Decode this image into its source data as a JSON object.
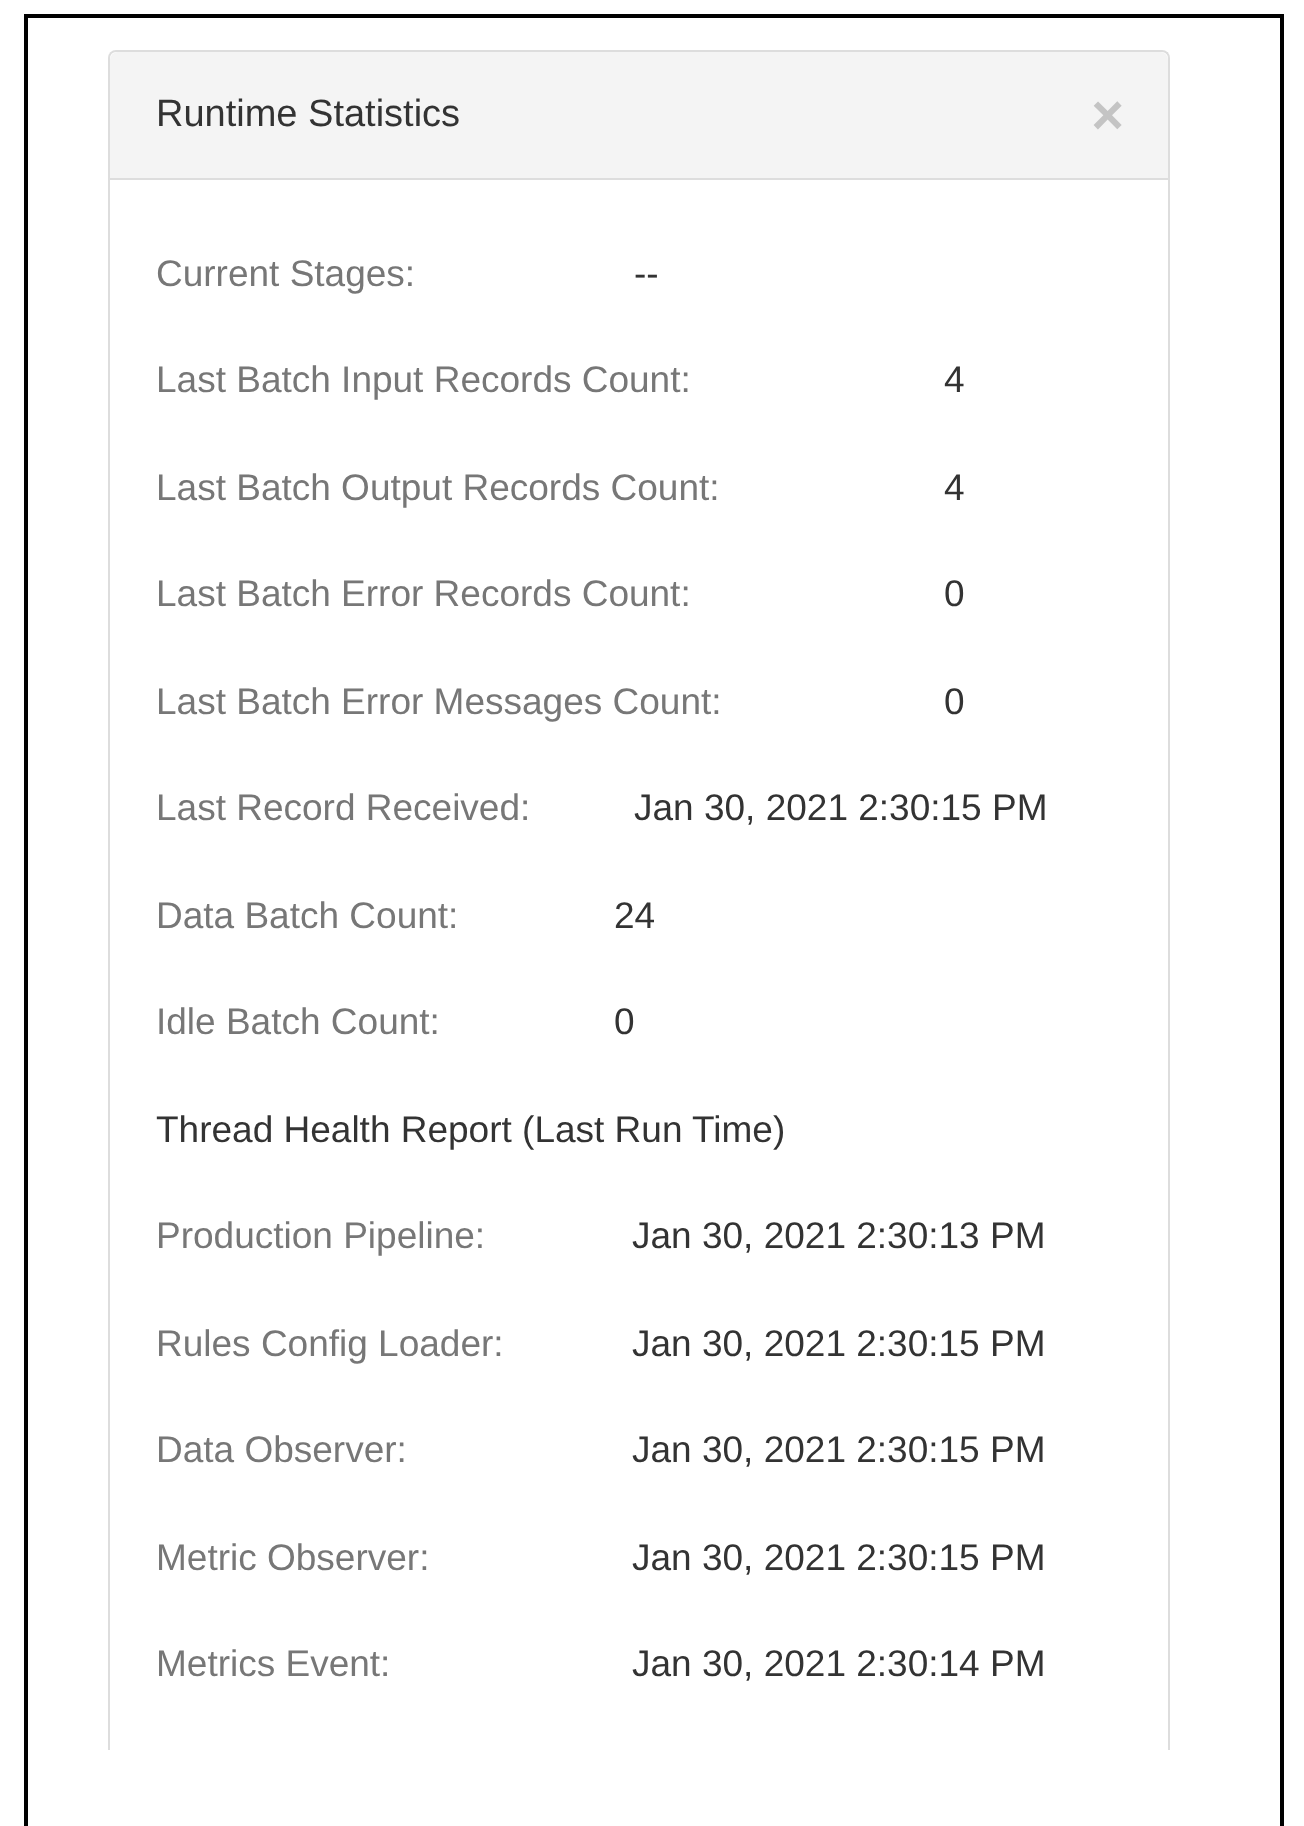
{
  "panel": {
    "title": "Runtime Statistics",
    "close": "×"
  },
  "sections": [
    {
      "kind": "stages",
      "rows": [
        {
          "label": "Current Stages:",
          "value": "--"
        }
      ]
    },
    {
      "kind": "counts",
      "rows": [
        {
          "label": "Last Batch Input Records Count:",
          "value": "4"
        },
        {
          "label": "Last Batch Output Records Count:",
          "value": "4"
        },
        {
          "label": "Last Batch Error Records Count:",
          "value": "0"
        },
        {
          "label": "Last Batch Error Messages Count:",
          "value": "0"
        }
      ]
    },
    {
      "kind": "record",
      "rows": [
        {
          "label": "Last Record Received:",
          "value": "Jan 30, 2021 2:30:15 PM"
        }
      ]
    },
    {
      "kind": "batches",
      "rows": [
        {
          "label": "Data Batch Count:",
          "value": "24"
        },
        {
          "label": "Idle Batch Count:",
          "value": "0"
        }
      ]
    },
    {
      "kind": "threads",
      "heading": "Thread Health Report (Last Run Time)",
      "rows": [
        {
          "label": "Production Pipeline:",
          "value": "Jan 30, 2021 2:30:13 PM"
        },
        {
          "label": "Rules Config Loader:",
          "value": "Jan 30, 2021 2:30:15 PM"
        },
        {
          "label": "Data Observer:",
          "value": "Jan 30, 2021 2:30:15 PM"
        },
        {
          "label": "Metric Observer:",
          "value": "Jan 30, 2021 2:30:15 PM"
        },
        {
          "label": "Metrics Event:",
          "value": "Jan 30, 2021 2:30:14 PM"
        }
      ]
    }
  ]
}
